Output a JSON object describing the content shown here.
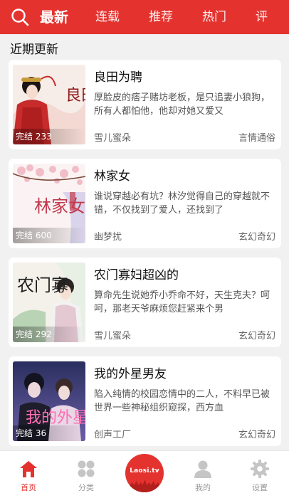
{
  "header": {
    "tabs": [
      {
        "label": "最新"
      },
      {
        "label": "连载"
      },
      {
        "label": "推荐"
      },
      {
        "label": "热门"
      },
      {
        "label": "评"
      }
    ]
  },
  "section_title": "近期更新",
  "books": [
    {
      "title": "良田为聘",
      "desc": "厚脸皮的痞子赌坊老板，是只追妻小狼狗，所有人都怕他，他却对她又爱又",
      "author": "雪儿蜜朵",
      "genre": "言情通俗",
      "badge": "完结 233",
      "cover_art_text": "良田为聘"
    },
    {
      "title": "林家女",
      "desc": "谁说穿越必有坑？林汐觉得自己的穿越就不错，不仅找到了爱人，还找到了",
      "author": "幽梦扰",
      "genre": "玄幻奇幻",
      "badge": "完结 600",
      "cover_art_text": "林家女"
    },
    {
      "title": "农门寡妇超凶的",
      "desc": "算命先生说她乔小乔命不好，天生克夫？呵呵，那老天爷麻烦您赶紧来个男",
      "author": "雪儿蜜朵",
      "genre": "玄幻奇幻",
      "badge": "完结 292",
      "cover_art_text": "农门寡"
    },
    {
      "title": "我的外星男友",
      "desc": "陷入纯情的校园恋情中的二人，不料早已被世界一些神秘组织窥探，西方血",
      "author": "创声工厂",
      "genre": "玄幻奇幻",
      "badge": "完结 36",
      "cover_art_text": "我的外星"
    }
  ],
  "bottom_nav": {
    "home": "首页",
    "category": "分类",
    "logo": "Laosi.tv",
    "mine": "我的",
    "settings": "设置"
  },
  "colors": {
    "accent": "#e4332f",
    "inactive": "#999999"
  },
  "icons": [
    "search-icon",
    "home-icon",
    "category-icon",
    "app-logo-icon",
    "user-icon",
    "gear-icon"
  ]
}
